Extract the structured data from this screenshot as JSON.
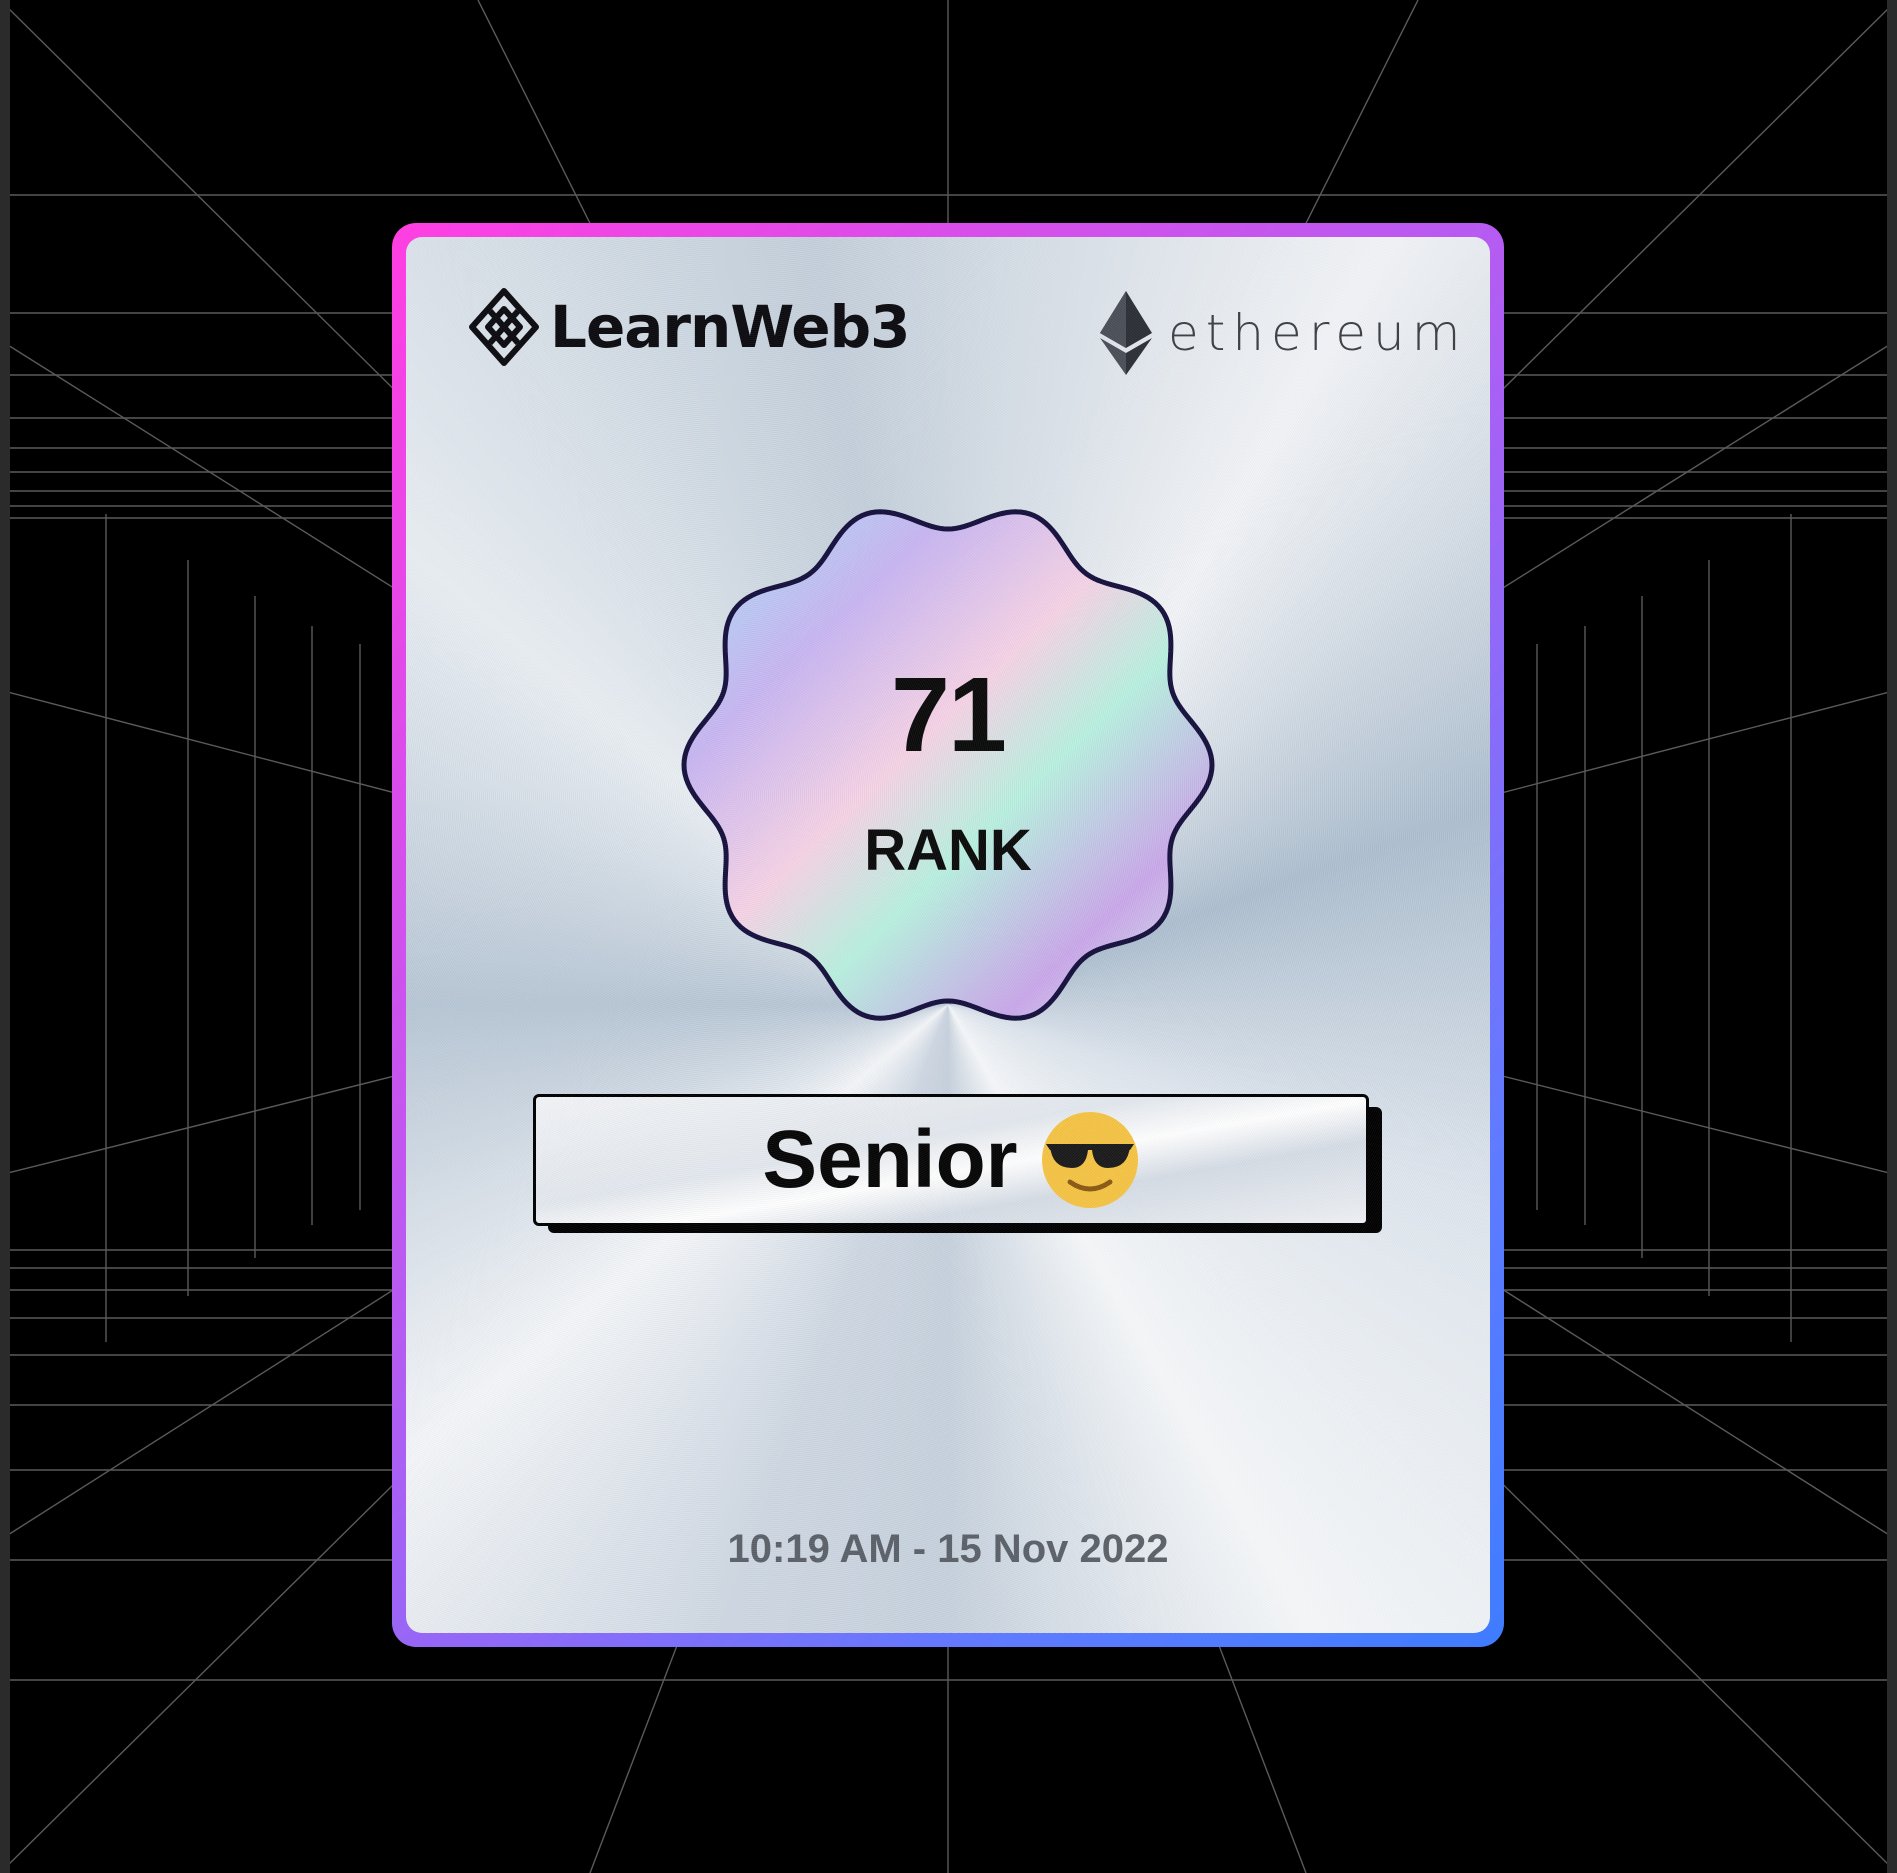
{
  "card": {
    "brand_left": "LearnWeb3",
    "brand_right": "ethereum",
    "rank_value": "71",
    "rank_label": "RANK",
    "title": "Senior",
    "title_emoji": "smiling-face-with-sunglasses-icon",
    "timestamp": "10:19 AM - 15 Nov 2022"
  },
  "colors": {
    "background": "#000000",
    "grid_line": "#5a5a5a",
    "border_gradient": [
      "#ff3fe2",
      "#b45cf2",
      "#3f7cff"
    ],
    "text_dark": "#0a0a0a",
    "timestamp": "#5c6169"
  }
}
